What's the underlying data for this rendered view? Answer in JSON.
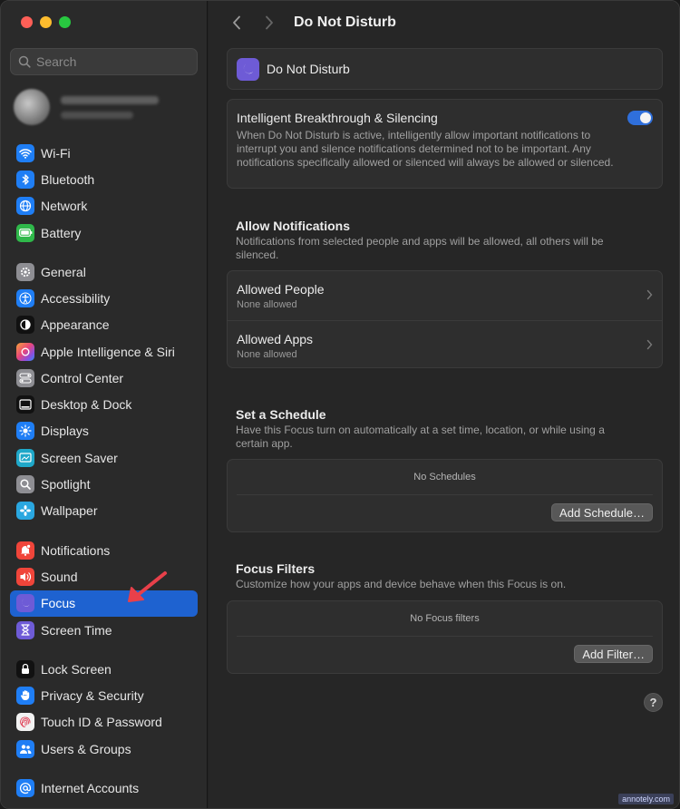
{
  "window": {
    "title": "Do Not Disturb"
  },
  "search": {
    "placeholder": "Search"
  },
  "sidebar": {
    "groups": [
      [
        {
          "label": "Wi-Fi",
          "icon": "wifi-icon",
          "color": "#1f7ef5"
        },
        {
          "label": "Bluetooth",
          "icon": "bluetooth-icon",
          "color": "#1f7ef5"
        },
        {
          "label": "Network",
          "icon": "globe-icon",
          "color": "#1f7ef5"
        },
        {
          "label": "Battery",
          "icon": "battery-icon",
          "color": "#2fb84a"
        }
      ],
      [
        {
          "label": "General",
          "icon": "gear-icon",
          "color": "#8e8e93"
        },
        {
          "label": "Accessibility",
          "icon": "accessibility-icon",
          "color": "#1f7ef5"
        },
        {
          "label": "Appearance",
          "icon": "appearance-icon",
          "color": "#111111"
        },
        {
          "label": "Apple Intelligence & Siri",
          "icon": "siri-icon",
          "color": "#b14fd6"
        },
        {
          "label": "Control Center",
          "icon": "control-center-icon",
          "color": "#8e8e93"
        },
        {
          "label": "Desktop & Dock",
          "icon": "dock-icon",
          "color": "#111111"
        },
        {
          "label": "Displays",
          "icon": "sun-icon",
          "color": "#1f7ef5"
        },
        {
          "label": "Screen Saver",
          "icon": "screen-saver-icon",
          "color": "#1fa8c9"
        },
        {
          "label": "Spotlight",
          "icon": "magnifier-icon",
          "color": "#8e8e93"
        },
        {
          "label": "Wallpaper",
          "icon": "flower-icon",
          "color": "#2aa7e0"
        }
      ],
      [
        {
          "label": "Notifications",
          "icon": "bell-icon",
          "color": "#f0453a"
        },
        {
          "label": "Sound",
          "icon": "speaker-icon",
          "color": "#f0453a"
        },
        {
          "label": "Focus",
          "icon": "moon-icon",
          "color": "#6e5bd6",
          "active": true
        },
        {
          "label": "Screen Time",
          "icon": "hourglass-icon",
          "color": "#6e5bd6"
        }
      ],
      [
        {
          "label": "Lock Screen",
          "icon": "lock-icon",
          "color": "#111111"
        },
        {
          "label": "Privacy & Security",
          "icon": "hand-icon",
          "color": "#1f7ef5"
        },
        {
          "label": "Touch ID & Password",
          "icon": "fingerprint-icon",
          "color": "#f2f2f2"
        },
        {
          "label": "Users & Groups",
          "icon": "users-icon",
          "color": "#1f7ef5"
        }
      ],
      [
        {
          "label": "Internet Accounts",
          "icon": "at-icon",
          "color": "#1f7ef5"
        }
      ]
    ]
  },
  "main": {
    "header_label": "Do Not Disturb",
    "intelligent": {
      "title": "Intelligent Breakthrough & Silencing",
      "description": "When Do Not Disturb is active, intelligently allow important notifications to interrupt you and silence notifications determined not to be important. Any notifications specifically allowed or silenced will always be allowed or silenced.",
      "enabled": true
    },
    "allow": {
      "title": "Allow Notifications",
      "description": "Notifications from selected people and apps will be allowed, all others will be silenced.",
      "rows": [
        {
          "title": "Allowed People",
          "sub": "None allowed"
        },
        {
          "title": "Allowed Apps",
          "sub": "None allowed"
        }
      ]
    },
    "schedule": {
      "title": "Set a Schedule",
      "description": "Have this Focus turn on automatically at a set time, location, or while using a certain app.",
      "empty": "No Schedules",
      "button": "Add Schedule…"
    },
    "filters": {
      "title": "Focus Filters",
      "description": "Customize how your apps and device behave when this Focus is on.",
      "empty": "No Focus filters",
      "button": "Add Filter…"
    },
    "help": "?"
  },
  "watermark": "annotely.com"
}
